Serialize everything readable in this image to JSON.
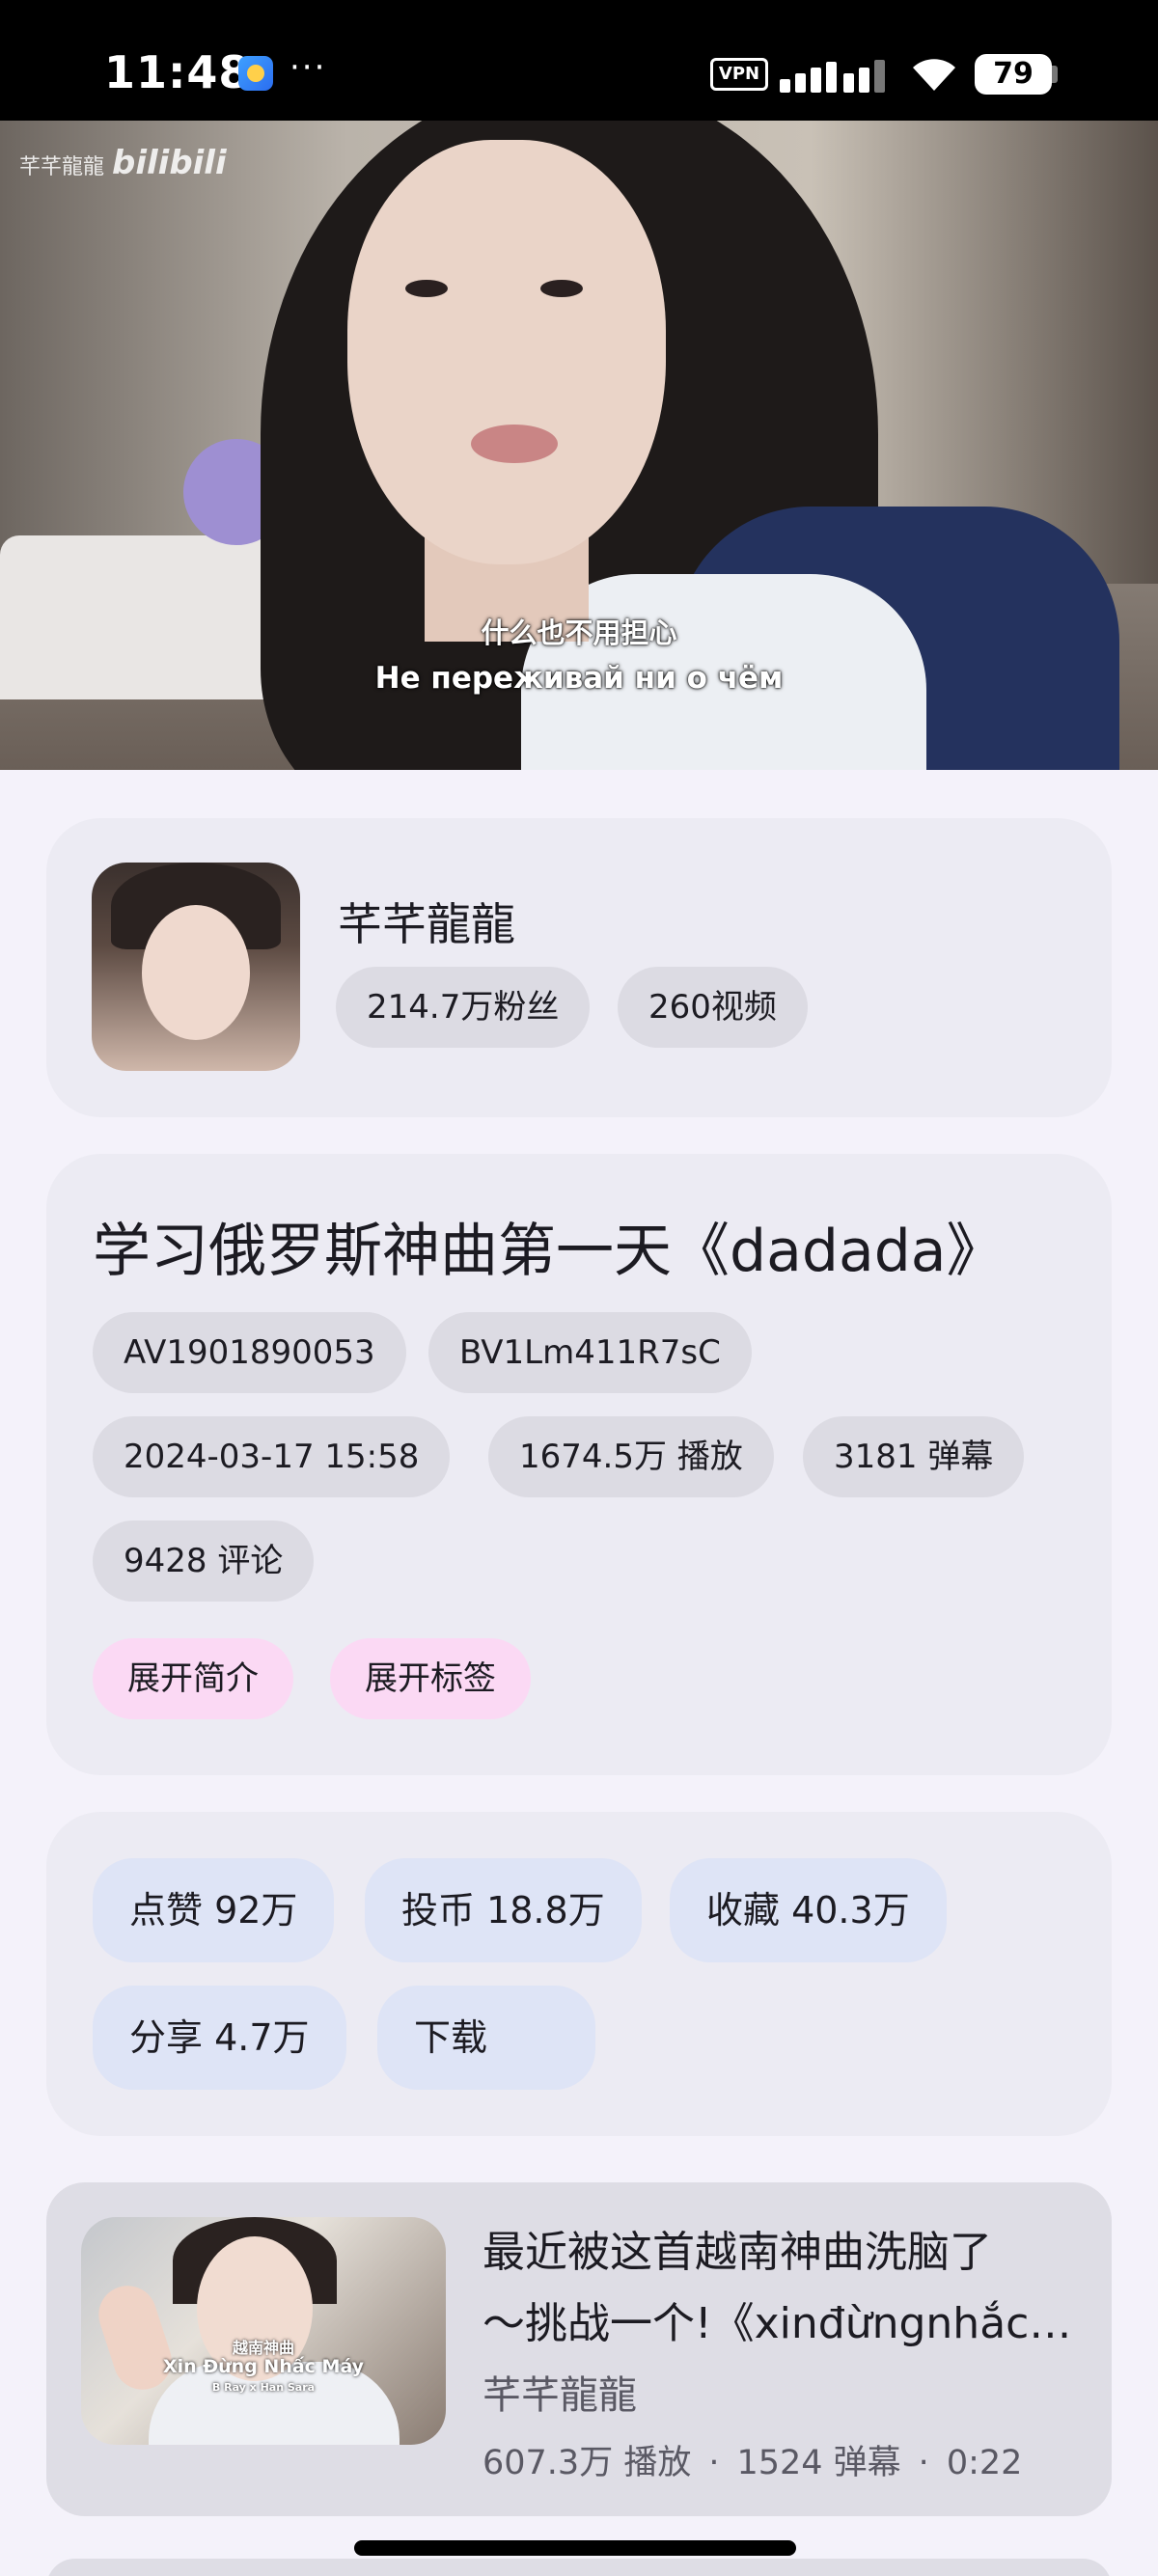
{
  "status_bar": {
    "time": "11:48",
    "more": "···",
    "vpn": "VPN",
    "battery": "79",
    "icons": [
      "app-icon",
      "vpn-icon",
      "signal-icon",
      "wifi-icon",
      "battery-icon"
    ]
  },
  "video": {
    "watermark_name": "芊芊龍龍",
    "watermark_brand": "bilibili",
    "subtitle_cn": "什么也不用担心",
    "subtitle_ru": "Не переживай ни о чём"
  },
  "uploader": {
    "name": "芊芊龍龍",
    "fans": "214.7万粉丝",
    "videos": "260视频"
  },
  "video_info": {
    "title": "学习俄罗斯神曲第一天《dadada》",
    "av": "AV1901890053",
    "bv": "BV1Lm411R7sC",
    "date": "2024-03-17 15:58",
    "plays": "1674.5万 播放",
    "danmaku": "3181 弹幕",
    "comments": "9428 评论",
    "expand_intro": "展开简介",
    "expand_tags": "展开标签"
  },
  "actions": {
    "like": "点赞  92万",
    "coin": "投币  18.8万",
    "favorite": "收藏  40.3万",
    "share": "分享  4.7万",
    "download": "下载"
  },
  "recommendations": [
    {
      "title_line1": "最近被这首越南神曲洗脑了",
      "title_line2": "～挑战一个!《xinđừngnhắcmáy》",
      "author": "芊芊龍龍",
      "plays": "607.3万 播放",
      "danmaku": "1524 弹幕",
      "duration": "0:22",
      "thumb_text_1": "越南神曲",
      "thumb_text_2": "Xin Đừng Nhấc Máy",
      "thumb_text_3": "B Ray x Han Sara"
    }
  ],
  "meta_separator": "·"
}
